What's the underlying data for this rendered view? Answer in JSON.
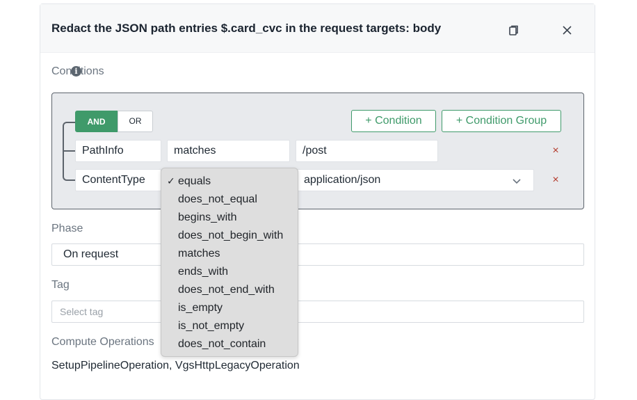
{
  "modal": {
    "title": "Redact the JSON path entries $.card_cvc in the request targets: body",
    "copy_icon": "copy-icon",
    "close_icon": "close-icon"
  },
  "conditions": {
    "label": "Conditions",
    "info_icon": "i",
    "and_label": "AND",
    "or_label": "OR",
    "add_condition": "+ Condition",
    "add_condition_group": "+ Condition Group",
    "rows": [
      {
        "field": "PathInfo",
        "operator": "matches",
        "value": "/post",
        "remove": "×"
      },
      {
        "field": "ContentType",
        "operator": "equals",
        "value": "application/json",
        "remove": "×"
      }
    ]
  },
  "operator_dropdown": {
    "selected": "equals",
    "check_mark": "✓",
    "options": [
      "equals",
      "does_not_equal",
      "begins_with",
      "does_not_begin_with",
      "matches",
      "ends_with",
      "does_not_end_with",
      "is_empty",
      "is_not_empty",
      "does_not_contain"
    ]
  },
  "phase": {
    "label": "Phase",
    "value": "On request"
  },
  "tag": {
    "label": "Tag",
    "placeholder": "Select tag"
  },
  "compute": {
    "label": "Compute Operations",
    "value": "SetupPipelineOperation, VgsHttpLegacyOperation"
  },
  "colors": {
    "accent": "#3f9a6a",
    "danger": "#b33a2c",
    "border": "#5c636b"
  }
}
